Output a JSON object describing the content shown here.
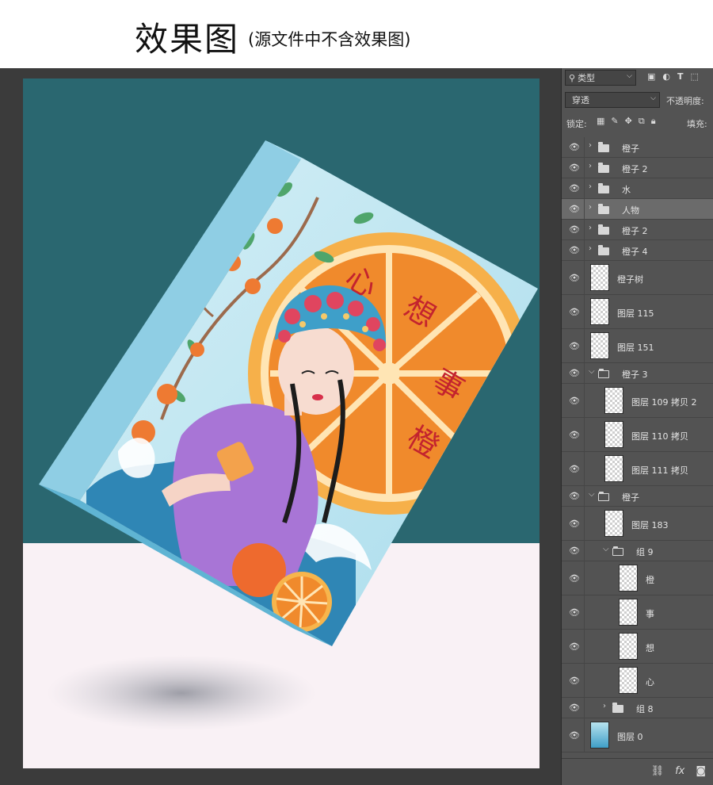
{
  "caption": {
    "main": "效果图",
    "sub": "(源文件中不含效果图)"
  },
  "artwork": {
    "title_chars": [
      "心",
      "想",
      "事",
      "橙"
    ]
  },
  "layers_panel": {
    "filter": {
      "label": "类型",
      "icons": [
        "image-filter-icon",
        "adjustment-filter-icon",
        "type-filter-icon",
        "shape-filter-icon"
      ]
    },
    "blend_mode": "穿透",
    "opacity_label": "不透明度:",
    "lock_label": "锁定:",
    "fill_label": "填充:",
    "layers": [
      {
        "name": "橙子",
        "type": "group",
        "expanded": false,
        "indent": 0
      },
      {
        "name": "橙子 2",
        "type": "group",
        "expanded": false,
        "indent": 0
      },
      {
        "name": "水",
        "type": "group",
        "expanded": false,
        "indent": 0
      },
      {
        "name": "人物",
        "type": "group",
        "expanded": false,
        "indent": 0,
        "selected": true
      },
      {
        "name": "橙子 2",
        "type": "group",
        "expanded": false,
        "indent": 0
      },
      {
        "name": "橙子 4",
        "type": "group",
        "expanded": false,
        "indent": 0
      },
      {
        "name": "橙子树",
        "type": "layer",
        "indent": 0
      },
      {
        "name": "图层 115",
        "type": "layer",
        "indent": 0
      },
      {
        "name": "图层 151",
        "type": "layer",
        "indent": 0
      },
      {
        "name": "橙子 3",
        "type": "group",
        "expanded": true,
        "indent": 0
      },
      {
        "name": "图层 109 拷贝 2",
        "type": "layer",
        "indent": 1
      },
      {
        "name": "图层 110 拷贝",
        "type": "layer",
        "indent": 1
      },
      {
        "name": "图层 111 拷贝",
        "type": "layer",
        "indent": 1
      },
      {
        "name": "橙子",
        "type": "group",
        "expanded": true,
        "indent": 0
      },
      {
        "name": "图层 183",
        "type": "layer",
        "indent": 1
      },
      {
        "name": "组 9",
        "type": "group",
        "expanded": true,
        "indent": 1
      },
      {
        "name": "橙",
        "type": "layer",
        "indent": 2
      },
      {
        "name": "事",
        "type": "layer",
        "indent": 2
      },
      {
        "name": "想",
        "type": "layer",
        "indent": 2
      },
      {
        "name": "心",
        "type": "layer",
        "indent": 2
      },
      {
        "name": "组 8",
        "type": "group",
        "expanded": false,
        "indent": 1
      },
      {
        "name": "图层 0",
        "type": "layer",
        "indent": 0,
        "thumb": "blue"
      }
    ],
    "footer_icons": [
      "link-icon",
      "fx-icon",
      "mask-icon"
    ]
  },
  "colors": {
    "canvas_top": "#2a6770",
    "canvas_bottom": "#f9f1f5",
    "panel_bg": "#535353",
    "workspace_bg": "#3b3b3b",
    "orange": "#f08a2c",
    "box_blue": "#8ecde3"
  }
}
